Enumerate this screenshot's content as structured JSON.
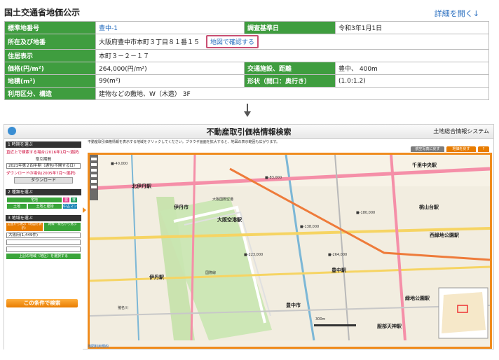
{
  "header": {
    "title": "国土交通省地価公示",
    "detail_link": "詳細を開く↓"
  },
  "info": {
    "row1": {
      "l1": "標準地番号",
      "v1": "豊中-1",
      "l2": "調査基準日",
      "v2": "令和3年1月1日"
    },
    "row2": {
      "l1": "所在及び地番",
      "v1": "大阪府豊中市本町３丁目８１番１５",
      "link": "地図で確認する"
    },
    "row3": {
      "l1": "住居表示",
      "v1": "本町３－２－１７"
    },
    "row4": {
      "l1": "価格(円/m²)",
      "v1": "264,000(円/m²)",
      "l2": "交通施設、距離",
      "v2": "豊中、 400m"
    },
    "row5": {
      "l1": "地積(m²)",
      "v1": "99(m²)",
      "l2": "形状（間口：奥行き）",
      "v2": "(1.0:1.2)"
    },
    "row6": {
      "l1": "利用区分、構造",
      "v1": "建物などの敷地、W（木造） 3F"
    }
  },
  "app": {
    "title": "不動産取引価格情報検索",
    "system": "土地総合情報システム",
    "instructions": "不動産取引価格情報を表示する地域をクリックしてください。ブラウザ画面を拡大すると、地図の表示範囲も広がります。",
    "left": {
      "sec1": "1 時期を選ぶ",
      "note1": "直近上で検索する場合(2016年1月～選択)",
      "period_label": "取引期間",
      "from": "2021年第２四半期（通告/不開する日）",
      "note2": "ダウンロードの場合(2005年7月～選択)",
      "download": "ダウンロード",
      "sec2": "2 種類を選ぶ",
      "types": [
        "宅地",
        "",
        "農地",
        "林地",
        "土地",
        "土地と建物",
        "中古マンション等"
      ],
      "sec3": "3 地域を選ぶ",
      "area_tabs": [
        "全国から選ぶ（地図を表示）",
        "路線・駅名から選ぶ"
      ],
      "pref": "大阪府(1,449件)",
      "city": "",
      "district": "",
      "list_btn": "上記の地域（地区）を選択する",
      "search": "この条件で検索"
    },
    "tabs": [
      "航空写真に戻す",
      "地価を戻す"
    ],
    "footer": "地図利用規約"
  },
  "map": {
    "stations": [
      "北伊丹駅",
      "伊丹駅",
      "伊丹駅",
      "大阪空港駅",
      "千里中央駅",
      "桃山台駅",
      "豊中駅",
      "西緑地公園駅",
      "緑地公園駅",
      "服部天神駅"
    ],
    "places": [
      "伊丹市",
      "豊中市",
      "大阪国際空港",
      "国際線",
      "猪名川"
    ],
    "price_labels": [
      "■-40,000",
      "■-83,000",
      "■-138,000",
      "■-180,000",
      "■-223,000",
      "■-264,000"
    ],
    "scale": "300m"
  }
}
